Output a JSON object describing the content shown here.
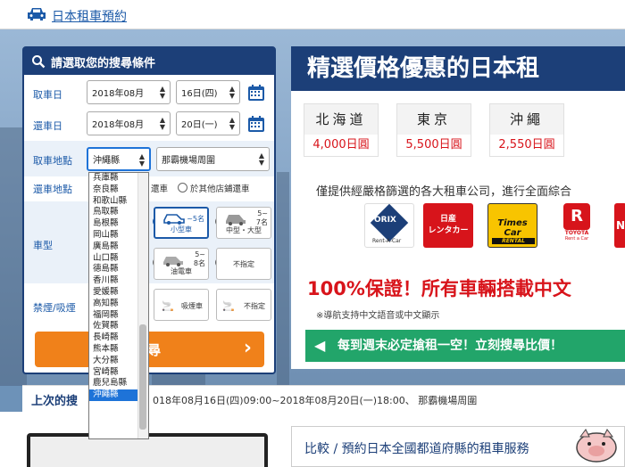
{
  "header": {
    "title": "日本租車預約",
    "icon": "car-icon"
  },
  "panel": {
    "title": "請選取您的搜尋條件",
    "pickup_date_label": "取車日",
    "pickup_month": "2018年08月",
    "pickup_day": "16日(四)",
    "return_date_label": "還車日",
    "return_month": "2018年08月",
    "return_day": "20日(一)",
    "pickup_place_label": "取車地點",
    "pickup_prefecture": "沖繩縣",
    "pickup_store": "那霸機場周圍",
    "return_place_label": "還車地點",
    "return_opt_same": "還車",
    "return_opt_other": "於其他店鋪還車",
    "car_type_label": "車型",
    "car_small_label": "小型車",
    "car_small_seats": "~5名",
    "car_mid_label": "中型・大型",
    "car_mid_seats_top": "5~",
    "car_mid_seats_bottom": "7名",
    "car_eco_label": "油電車",
    "car_eco_seats_top": "5~",
    "car_eco_seats_bottom": "8名",
    "car_any_label": "不指定",
    "smoking_label": "禁煙/吸煙",
    "smoking_ok": "吸煙車",
    "smoking_any": "不指定",
    "search_button": "尋",
    "chevron": "›"
  },
  "dropdown": {
    "options": [
      "兵庫縣",
      "奈良縣",
      "和歌山縣",
      "鳥取縣",
      "島根縣",
      "岡山縣",
      "廣島縣",
      "山口縣",
      "德島縣",
      "香川縣",
      "愛媛縣",
      "高知縣",
      "福岡縣",
      "佐賀縣",
      "長崎縣",
      "熊本縣",
      "大分縣",
      "宮崎縣",
      "鹿兒島縣",
      "沖繩縣"
    ],
    "selected_index": 19
  },
  "promo": {
    "title": "精選價格優惠的日本租",
    "regions": [
      {
        "name": "北海道",
        "price": "4,000日圓"
      },
      {
        "name": "東京",
        "price": "5,500日圓"
      },
      {
        "name": "沖繩",
        "price": "2,550日圓"
      }
    ],
    "partners_text": "僅提供經嚴格篩選的各大租車公司，進行全面綜合",
    "logos": [
      {
        "name": "ORIX",
        "sub": "Rent-A-Car",
        "color": "#ffffff"
      },
      {
        "name": "日産\nレンタカー",
        "color": "#d7141b"
      },
      {
        "name": "Times\nCar",
        "sub": "RENTAL",
        "color": "#f8c400"
      },
      {
        "name": "TOYOTA",
        "sub": "Rent a Car",
        "color": "#ffffff"
      },
      {
        "name": "N",
        "color": "#d7141b"
      }
    ],
    "guarantee": "100%保證！所有車輛搭載中文",
    "nav_note": "※導航支持中文語音或中文顯示",
    "green_banner": "每到週末必定搶租一空！立刻搜尋比價！"
  },
  "last_search": {
    "title": "上次的搜",
    "value": "018年08月16日(四)09:00~2018年08月20日(一)18:00、 那霸機場周圍"
  },
  "compare": {
    "title": "比較 / 預約日本全國都道府縣的租車服務"
  },
  "colors": {
    "navy": "#1c3f78",
    "orange": "#f0811a",
    "green": "#22a56a",
    "red": "#d8141b"
  }
}
